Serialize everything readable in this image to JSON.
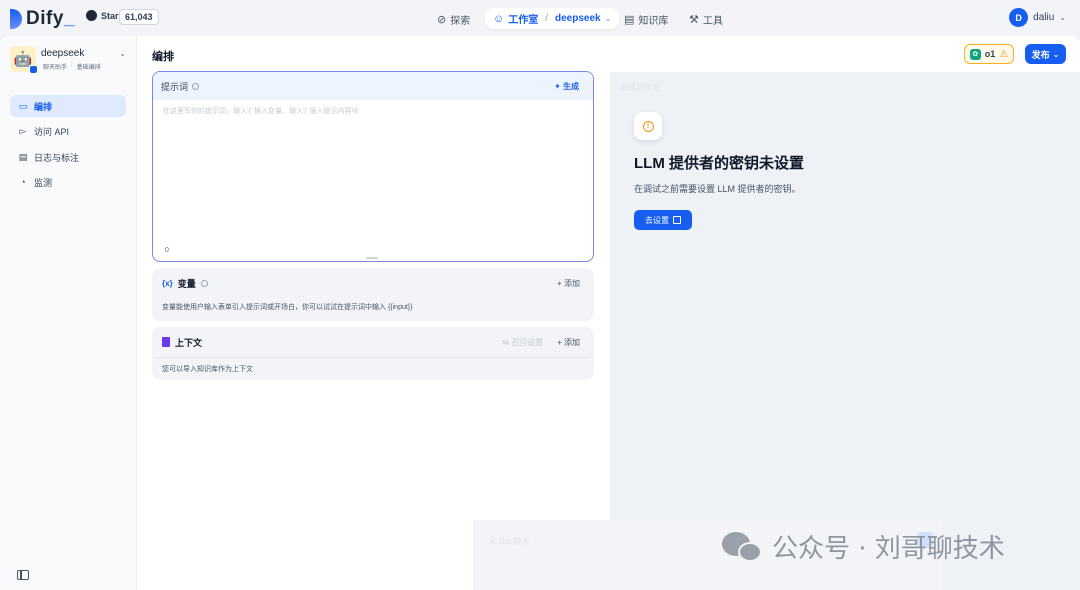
{
  "header": {
    "logo_text": "Dify",
    "github_label": "Star",
    "github_count": "61,043",
    "nav": {
      "explore": "探索",
      "studio": "工作室",
      "current_app": "deepseek",
      "knowledge": "知识库",
      "tools": "工具"
    },
    "user": {
      "initial": "D",
      "name": "daliu"
    }
  },
  "sidebar": {
    "app_name": "deepseek",
    "app_type": "聊天助手",
    "app_mode": "基础编排",
    "items": [
      {
        "label": "编排",
        "active": true
      },
      {
        "label": "访问 API",
        "active": false
      },
      {
        "label": "日志与标注",
        "active": false
      },
      {
        "label": "监测",
        "active": false
      }
    ]
  },
  "main": {
    "title": "编排",
    "model_label": "o1",
    "publish_label": "发布",
    "prompt": {
      "label": "提示词",
      "generate_label": "生成",
      "placeholder": "在这里写你的提示词，输入'{' 插入变量、输入'/' 插入提示内容块",
      "char_count": "0"
    },
    "variables": {
      "title": "变量",
      "add_label": "添加",
      "description": "变量能使用户输入表单引入提示词或开场白，你可以试试在提示词中输入 {{input}}"
    },
    "context": {
      "title": "上下文",
      "recall_label": "召回设置",
      "add_label": "添加",
      "description": "您可以导入知识库作为上下文"
    }
  },
  "debug": {
    "faint_title": "调试与预览",
    "warning_title": "LLM 提供者的密钥未设置",
    "warning_desc": "在调试之前需要设置 LLM 提供者的密钥。",
    "setup_label": "去设置",
    "input_placeholder": "和 Bot 聊天"
  },
  "watermark": {
    "text": "公众号 · 刘哥聊技术"
  },
  "colors": {
    "accent": "#155eef",
    "warning": "#f79009",
    "active_bg": "#e0eaff"
  }
}
